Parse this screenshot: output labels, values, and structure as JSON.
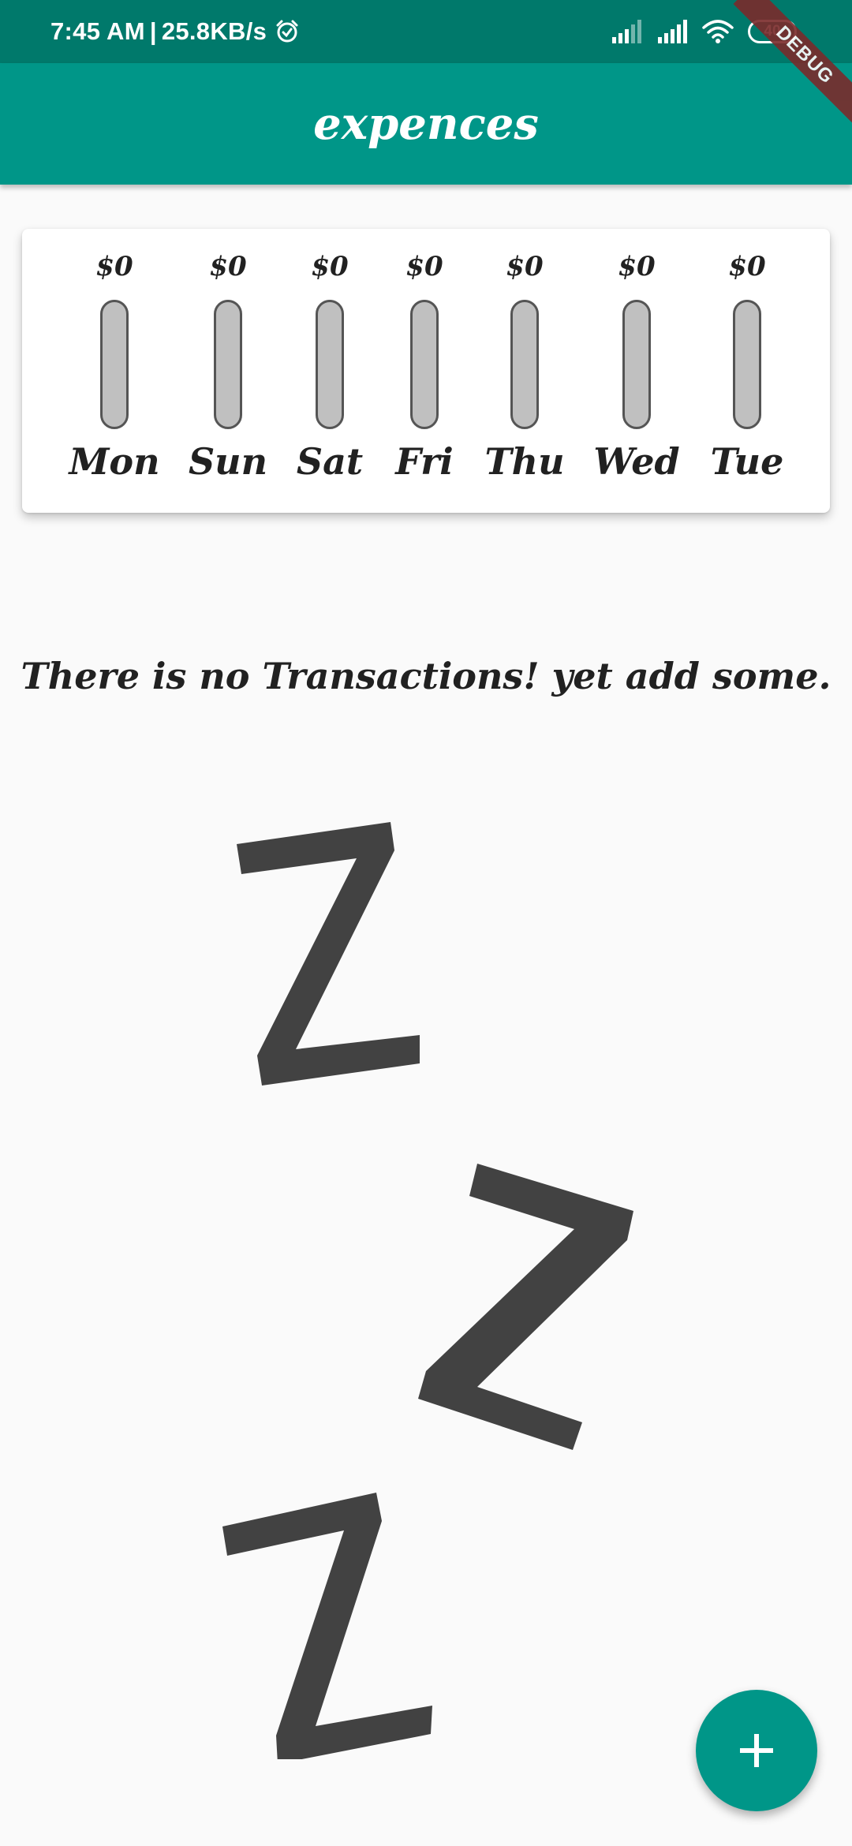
{
  "status_bar": {
    "time": "7:45 AM",
    "separator": "|",
    "network_speed": "25.8KB/s",
    "alarm_icon": "alarm-icon",
    "signal_icons": [
      "signal-1-icon",
      "signal-2-icon"
    ],
    "wifi_icon": "wifi-icon",
    "battery_level": "40"
  },
  "debug_banner": "DEBUG",
  "app_bar": {
    "title": "expences"
  },
  "chart": {
    "bars": [
      {
        "day": "Mon",
        "amount": "$0",
        "fraction": 0
      },
      {
        "day": "Sun",
        "amount": "$0",
        "fraction": 0
      },
      {
        "day": "Sat",
        "amount": "$0",
        "fraction": 0
      },
      {
        "day": "Fri",
        "amount": "$0",
        "fraction": 0
      },
      {
        "day": "Thu",
        "amount": "$0",
        "fraction": 0
      },
      {
        "day": "Wed",
        "amount": "$0",
        "fraction": 0
      },
      {
        "day": "Tue",
        "amount": "$0",
        "fraction": 0
      }
    ],
    "track_color": "#c0c0c0",
    "fill_color": "#009688"
  },
  "empty_state": {
    "message": "There is no Transactions! yet add some.",
    "illustration": "sleeping-zzz-illustration"
  },
  "fab": {
    "icon": "plus-icon",
    "color": "#009688"
  },
  "colors": {
    "primary": "#009688",
    "primary_dark": "#00796b",
    "background": "#fafafa",
    "text": "#212121"
  }
}
